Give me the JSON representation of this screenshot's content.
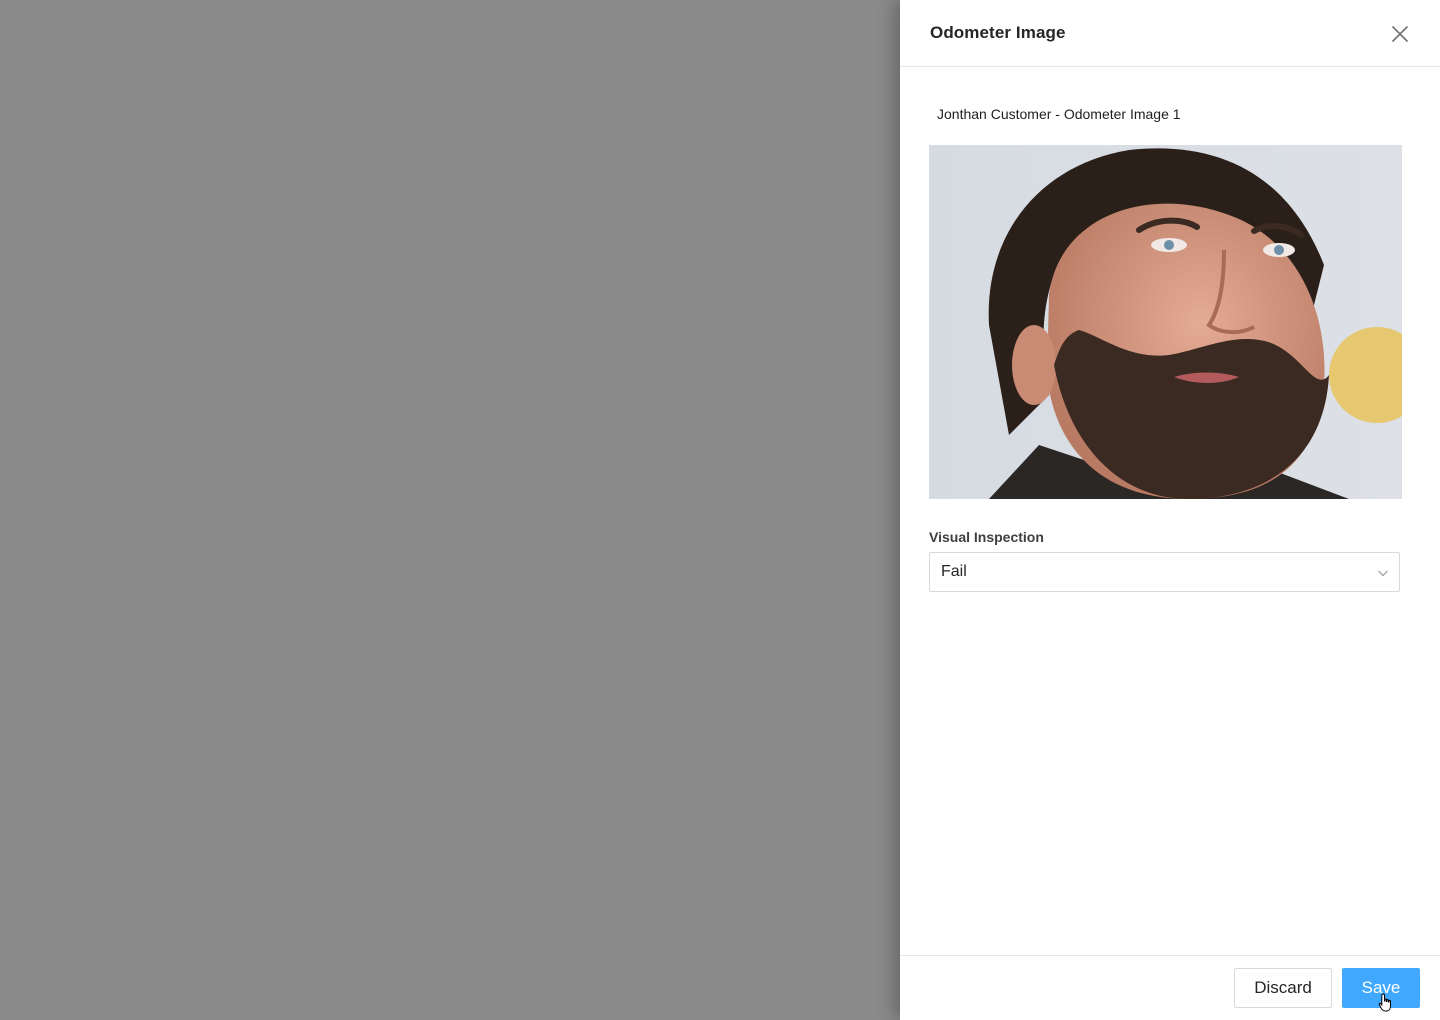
{
  "drawer": {
    "title": "Odometer Image",
    "close_icon": "close-icon"
  },
  "image": {
    "caption": "Jonthan Customer - Odometer Image 1",
    "content": "portrait-photo"
  },
  "form": {
    "visual_inspection_label": "Visual Inspection",
    "visual_inspection_value": "Fail",
    "dropdown_icon": "chevron-down-icon"
  },
  "footer": {
    "discard_label": "Discard",
    "save_label": "Save"
  },
  "colors": {
    "backdrop": "#8a8a8a",
    "primary": "#40a9ff",
    "border": "#d9d9d9"
  }
}
